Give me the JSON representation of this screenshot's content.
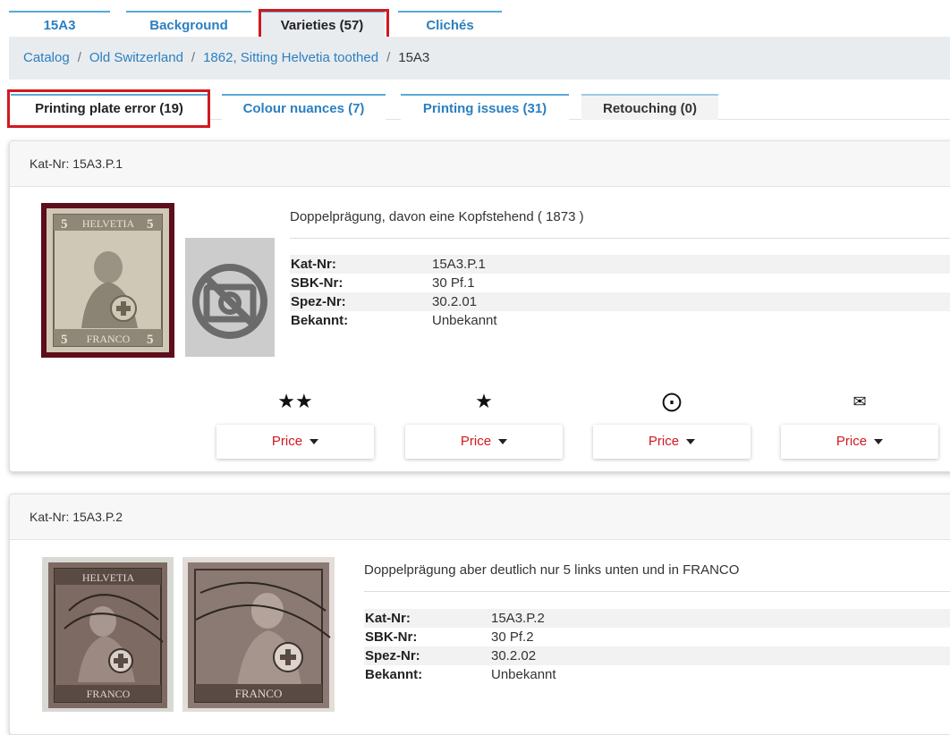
{
  "top_tabs": [
    {
      "label": "15A3"
    },
    {
      "label": "Background"
    },
    {
      "label": "Varieties (57)"
    },
    {
      "label": "Clichés"
    }
  ],
  "breadcrumb": {
    "items": [
      "Catalog",
      "Old Switzerland",
      "1862, Sitting Helvetia toothed"
    ],
    "current": "15A3"
  },
  "variety_tabs": [
    {
      "label": "Printing plate error (19)"
    },
    {
      "label": "Colour nuances (7)"
    },
    {
      "label": "Printing issues (31)"
    },
    {
      "label": "Retouching (0)"
    }
  ],
  "cards": [
    {
      "header": "Kat-Nr: 15A3.P.1",
      "description": "Doppelprägung, davon eine Kopfstehend ( 1873 )",
      "details": [
        {
          "key": "Kat-Nr:",
          "value": "15A3.P.1"
        },
        {
          "key": "SBK-Nr:",
          "value": "30 Pf.1"
        },
        {
          "key": "Spez-Nr:",
          "value": "30.2.01"
        },
        {
          "key": "Bekannt:",
          "value": "Unbekannt"
        }
      ],
      "prices": [
        {
          "symbol": "★★",
          "label": "Price"
        },
        {
          "symbol": "★",
          "label": "Price"
        },
        {
          "symbol": "⨀",
          "label": "Price"
        },
        {
          "symbol": "✉",
          "label": "Price"
        }
      ]
    },
    {
      "header": "Kat-Nr: 15A3.P.2",
      "description": "Doppelprägung aber deutlich nur 5 links unten und in FRANCO",
      "details": [
        {
          "key": "Kat-Nr:",
          "value": "15A3.P.2"
        },
        {
          "key": "SBK-Nr:",
          "value": "30 Pf.2"
        },
        {
          "key": "Spez-Nr:",
          "value": "30.2.02"
        },
        {
          "key": "Bekannt:",
          "value": "Unbekannt"
        }
      ]
    }
  ],
  "stamp_text": {
    "top": "HELVETIA",
    "bottom": "FRANCO",
    "value": "5"
  },
  "colors": {
    "accent": "#2b7fc0",
    "highlight": "#d0191f",
    "price": "#d0191f"
  }
}
